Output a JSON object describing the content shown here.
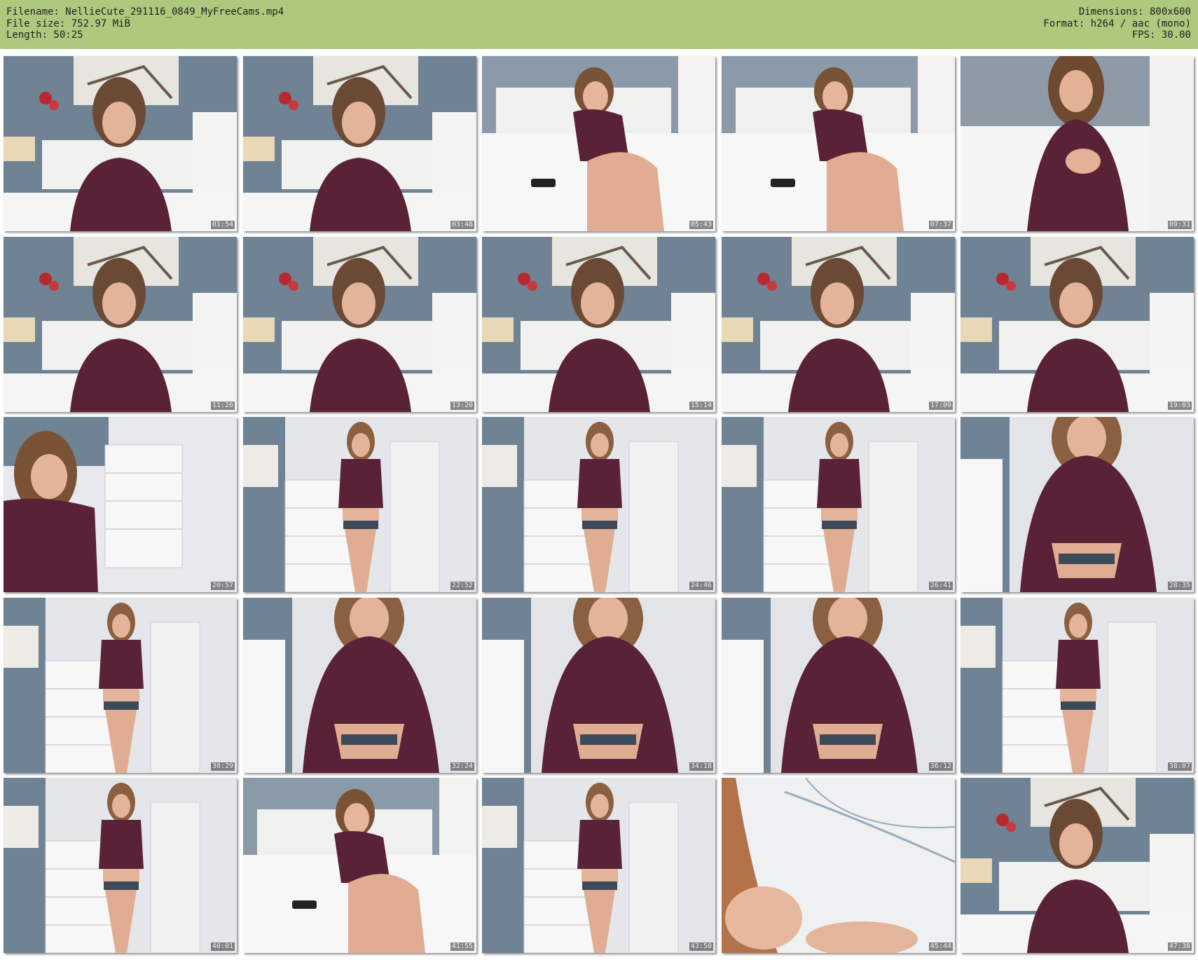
{
  "header": {
    "filename_line": "Filename: NellieCute_291116_0849_MyFreeCams.mp4",
    "filesize_line": "File size: 752.97 MiB",
    "length_line": "Length: 50:25",
    "dimensions_line": "Dimensions: 800x600",
    "format_line": "Format: h264 / aac (mono)",
    "fps_line": "FPS: 30.00"
  },
  "colors": {
    "header_bg": "#aec97d",
    "page_bg": "#ffffff"
  },
  "thumbnails": [
    {
      "timestamp": "01:54",
      "scene": "bedroom-sitting"
    },
    {
      "timestamp": "03:48",
      "scene": "bedroom-sitting"
    },
    {
      "timestamp": "05:43",
      "scene": "bed-reclining"
    },
    {
      "timestamp": "07:37",
      "scene": "bed-reclining"
    },
    {
      "timestamp": "09:31",
      "scene": "bed-close"
    },
    {
      "timestamp": "11:26",
      "scene": "bedroom-sitting"
    },
    {
      "timestamp": "13:20",
      "scene": "bedroom-sitting"
    },
    {
      "timestamp": "15:14",
      "scene": "bedroom-sitting"
    },
    {
      "timestamp": "17:09",
      "scene": "bedroom-sitting"
    },
    {
      "timestamp": "19:03",
      "scene": "bedroom-sitting"
    },
    {
      "timestamp": "20:57",
      "scene": "dresser-close"
    },
    {
      "timestamp": "22:52",
      "scene": "room-standing"
    },
    {
      "timestamp": "24:46",
      "scene": "room-standing"
    },
    {
      "timestamp": "26:41",
      "scene": "room-standing"
    },
    {
      "timestamp": "28:35",
      "scene": "room-close"
    },
    {
      "timestamp": "30:29",
      "scene": "room-standing"
    },
    {
      "timestamp": "32:24",
      "scene": "room-close"
    },
    {
      "timestamp": "34:18",
      "scene": "room-close"
    },
    {
      "timestamp": "36:12",
      "scene": "room-close"
    },
    {
      "timestamp": "38:07",
      "scene": "room-standing"
    },
    {
      "timestamp": "40:01",
      "scene": "room-standing"
    },
    {
      "timestamp": "41:55",
      "scene": "bed-reclining"
    },
    {
      "timestamp": "43:50",
      "scene": "room-standing"
    },
    {
      "timestamp": "45:44",
      "scene": "floor-closeup"
    },
    {
      "timestamp": "47:38",
      "scene": "bedroom-sitting"
    }
  ]
}
